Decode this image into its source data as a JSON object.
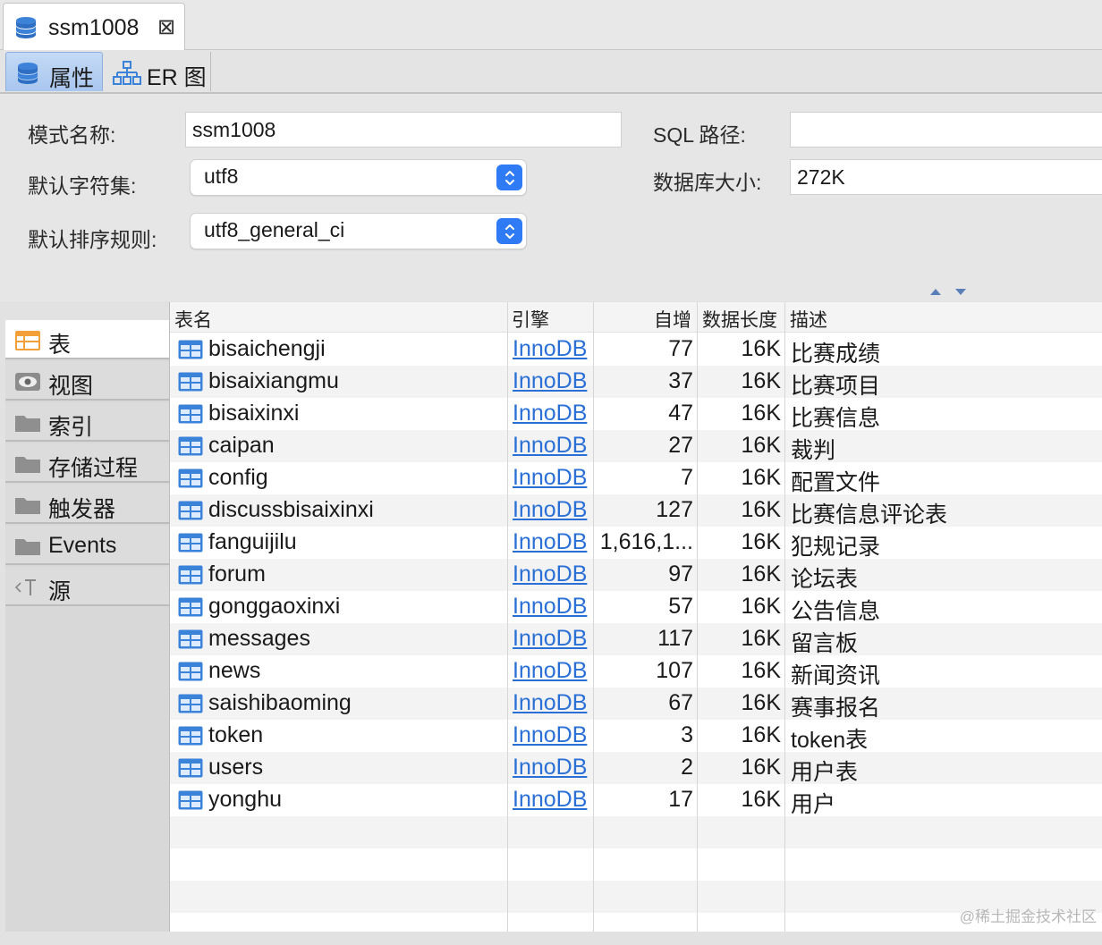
{
  "editor_tab": {
    "title": "ssm1008",
    "close_glyph": "⊠"
  },
  "subtabs": [
    {
      "label": "属性",
      "icon": "database-icon",
      "active": true
    },
    {
      "label": "ER 图",
      "icon": "er-diagram-icon",
      "active": false
    }
  ],
  "form": {
    "schema_name_label": "模式名称:",
    "schema_name_value": "ssm1008",
    "charset_label": "默认字符集:",
    "charset_value": "utf8",
    "collation_label": "默认排序规则:",
    "collation_value": "utf8_general_ci",
    "sql_path_label": "SQL 路径:",
    "sql_path_value": "",
    "db_size_label": "数据库大小:",
    "db_size_value": "272K"
  },
  "leftnav": [
    {
      "label": "表",
      "icon": "table-icon",
      "active": true
    },
    {
      "label": "视图",
      "icon": "view-eye-icon",
      "active": false
    },
    {
      "label": "索引",
      "icon": "folder-icon",
      "active": false
    },
    {
      "label": "存储过程",
      "icon": "folder-icon",
      "active": false
    },
    {
      "label": "触发器",
      "icon": "folder-icon",
      "active": false
    },
    {
      "label": "Events",
      "icon": "folder-icon",
      "active": false
    },
    {
      "label": "源",
      "icon": "source-code-icon",
      "active": false
    }
  ],
  "table": {
    "headers": {
      "name": "表名",
      "engine": "引擎",
      "auto_inc": "自增",
      "data_len": "数据长度",
      "desc": "描述"
    },
    "rows": [
      {
        "name": "bisaichengji",
        "engine": "InnoDB",
        "auto_inc": "77",
        "data_len": "16K",
        "desc": "比赛成绩"
      },
      {
        "name": "bisaixiangmu",
        "engine": "InnoDB",
        "auto_inc": "37",
        "data_len": "16K",
        "desc": "比赛项目"
      },
      {
        "name": "bisaixinxi",
        "engine": "InnoDB",
        "auto_inc": "47",
        "data_len": "16K",
        "desc": "比赛信息"
      },
      {
        "name": "caipan",
        "engine": "InnoDB",
        "auto_inc": "27",
        "data_len": "16K",
        "desc": "裁判"
      },
      {
        "name": "config",
        "engine": "InnoDB",
        "auto_inc": "7",
        "data_len": "16K",
        "desc": "配置文件"
      },
      {
        "name": "discussbisaixinxi",
        "engine": "InnoDB",
        "auto_inc": "127",
        "data_len": "16K",
        "desc": "比赛信息评论表"
      },
      {
        "name": "fanguijilu",
        "engine": "InnoDB",
        "auto_inc": "1,616,1...",
        "data_len": "16K",
        "desc": "犯规记录"
      },
      {
        "name": "forum",
        "engine": "InnoDB",
        "auto_inc": "97",
        "data_len": "16K",
        "desc": "论坛表"
      },
      {
        "name": "gonggaoxinxi",
        "engine": "InnoDB",
        "auto_inc": "57",
        "data_len": "16K",
        "desc": "公告信息"
      },
      {
        "name": "messages",
        "engine": "InnoDB",
        "auto_inc": "117",
        "data_len": "16K",
        "desc": "留言板"
      },
      {
        "name": "news",
        "engine": "InnoDB",
        "auto_inc": "107",
        "data_len": "16K",
        "desc": "新闻资讯"
      },
      {
        "name": "saishibaoming",
        "engine": "InnoDB",
        "auto_inc": "67",
        "data_len": "16K",
        "desc": "赛事报名"
      },
      {
        "name": "token",
        "engine": "InnoDB",
        "auto_inc": "3",
        "data_len": "16K",
        "desc": "token表"
      },
      {
        "name": "users",
        "engine": "InnoDB",
        "auto_inc": "2",
        "data_len": "16K",
        "desc": "用户表"
      },
      {
        "name": "yonghu",
        "engine": "InnoDB",
        "auto_inc": "17",
        "data_len": "16K",
        "desc": "用户"
      }
    ]
  },
  "watermark": "@稀土掘金技术社区",
  "colors": {
    "accent": "#2f7bf5",
    "link": "#2a6fd6",
    "table_icon": "#3b82d9",
    "tab_active": "#b9d1f2"
  }
}
